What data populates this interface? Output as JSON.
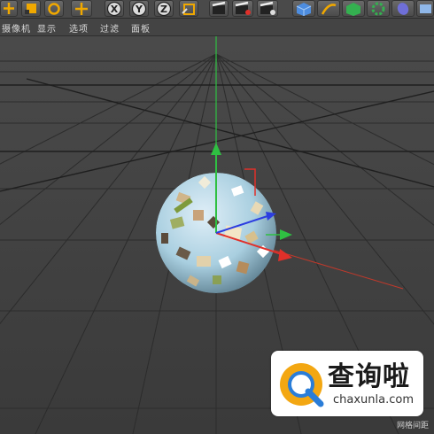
{
  "toolbar": {
    "axis_x": "X",
    "axis_y": "Y",
    "axis_z": "Z"
  },
  "menu": {
    "items": [
      "摄像机",
      "显示",
      "选项",
      "过滤",
      "面板"
    ]
  },
  "viewport": {
    "grid_spacing_label": "网格间距",
    "object": "sphere",
    "axis_colors": {
      "x": "#e0302a",
      "y": "#2fc042",
      "z": "#2c3de0"
    }
  },
  "watermark": {
    "text": "查询啦",
    "subtext": "chaxunla.com",
    "logo_icon": "magnifier-q-icon"
  }
}
